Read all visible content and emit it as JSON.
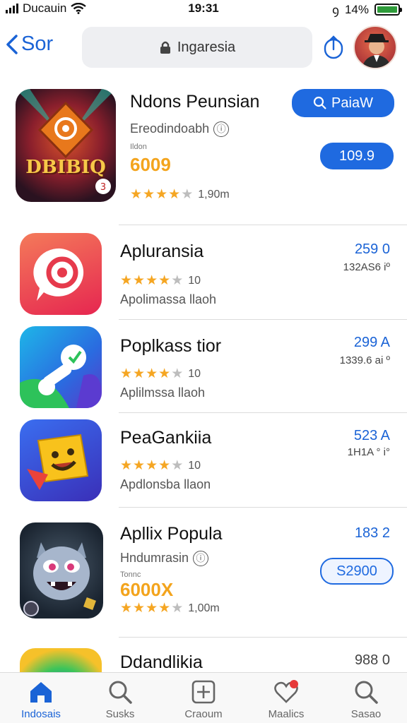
{
  "status_bar": {
    "carrier": "Ducauin",
    "time": "19:31",
    "battery": "14%"
  },
  "nav": {
    "back_label": "Sor",
    "search_text": "Ingaresia"
  },
  "featured": {
    "title": "Ndons Peunsian",
    "subtitle": "Ereodindoabh",
    "tiny_label": "Ildon",
    "coins": "6009",
    "rating_count": "1,90m",
    "icon_text": "DBIBIQ",
    "button_label": "PaiaW",
    "price_label": "109.9"
  },
  "apps": [
    {
      "title": "Apluransia",
      "rating_count": "10",
      "developer": "Apolimassa llaoh",
      "price": "259 0",
      "secondary": "132AS6 iº"
    },
    {
      "title": "Poplkass  tior",
      "rating_count": "10",
      "developer": "Aplilmssa llaoh",
      "price": "299 A",
      "secondary": "1339.6 ai º"
    },
    {
      "title": "PeaGankiia",
      "rating_count": "10",
      "developer": "Apdlonsba llaon",
      "price": "523 A",
      "secondary": "1H1A ° i°"
    }
  ],
  "featured2": {
    "title": "Apllix Popula",
    "subtitle": "Hndumrasin",
    "tiny_label": "Tonnc",
    "coins": "6000X",
    "rating_count": "1,00m",
    "price": "183 2",
    "button_label": "S2900"
  },
  "partial": {
    "title": "Ddandlikia",
    "price": "988 0"
  },
  "tabs": [
    {
      "label": "Indosais"
    },
    {
      "label": "Susks"
    },
    {
      "label": "Craoum"
    },
    {
      "label": "Maalics"
    },
    {
      "label": "Sasao"
    }
  ],
  "colors": {
    "accent": "#1a63d6",
    "star": "#f5a623",
    "coin": "#f3a41d"
  }
}
